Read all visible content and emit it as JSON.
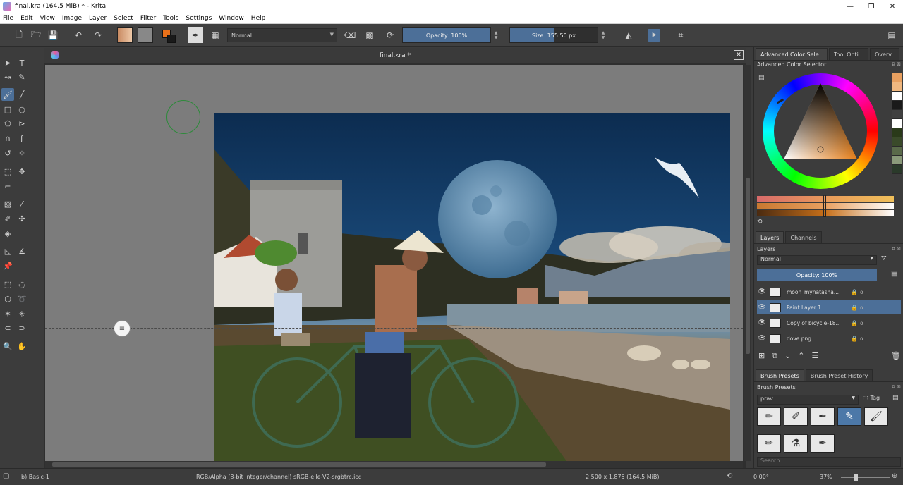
{
  "window": {
    "title": "final.kra (164.5 MiB)  * - Krita",
    "minimize": "—",
    "maximize": "❐",
    "close": "✕"
  },
  "menu": [
    "File",
    "Edit",
    "View",
    "Image",
    "Layer",
    "Select",
    "Filter",
    "Tools",
    "Settings",
    "Window",
    "Help"
  ],
  "toolbar": {
    "blend_mode": "Normal",
    "opacity_label": "Opacity: 100%",
    "opacity_value": 100,
    "size_label": "Size: 155.50 px",
    "size_fraction": 0.5,
    "colors": {
      "gradient_a": "#c88a62",
      "gradient_b": "#efc9a8",
      "pattern": "#888888",
      "fg": "#e8701a",
      "bg": "#1a1a1a"
    }
  },
  "document": {
    "tab_title": "final.kra *",
    "close": "✕"
  },
  "docker": {
    "top_tabs": [
      "Advanced Color Sele...",
      "Tool Opti...",
      "Overv..."
    ],
    "color_selector_title": "Advanced Color Selector",
    "palette": [
      "#e8a060",
      "#f0b880",
      "#ffffff",
      "#1a1a1a",
      "#404040",
      "#ffffff",
      "#2a3a1a",
      "#3a4a2a",
      "#5a6a4a",
      "#8a9a7a",
      "#2a3a2a"
    ],
    "layers_tabs": [
      "Layers",
      "Channels"
    ],
    "layers_title": "Layers",
    "layer_blend": "Normal",
    "layer_opacity_label": "Opacity:  100%",
    "layers": [
      {
        "name": "moon_mynatasha...",
        "selected": false
      },
      {
        "name": "Paint Layer 1",
        "selected": true
      },
      {
        "name": "Copy of bicycle-18...",
        "selected": false
      },
      {
        "name": "dove.png",
        "selected": false
      }
    ],
    "presets_tabs": [
      "Brush Presets",
      "Brush Preset History"
    ],
    "presets_title": "Brush Presets",
    "preset_filter": "prav",
    "tag_label": "Tag",
    "search_placeholder": "Search"
  },
  "status": {
    "brush": "b) Basic-1",
    "color_space": "RGB/Alpha (8-bit integer/channel)  sRGB-elle-V2-srgbtrc.icc",
    "dimensions": "2,500 x 1,875 (164.5 MiB)",
    "rotation": "0.00°",
    "zoom": "37%"
  }
}
